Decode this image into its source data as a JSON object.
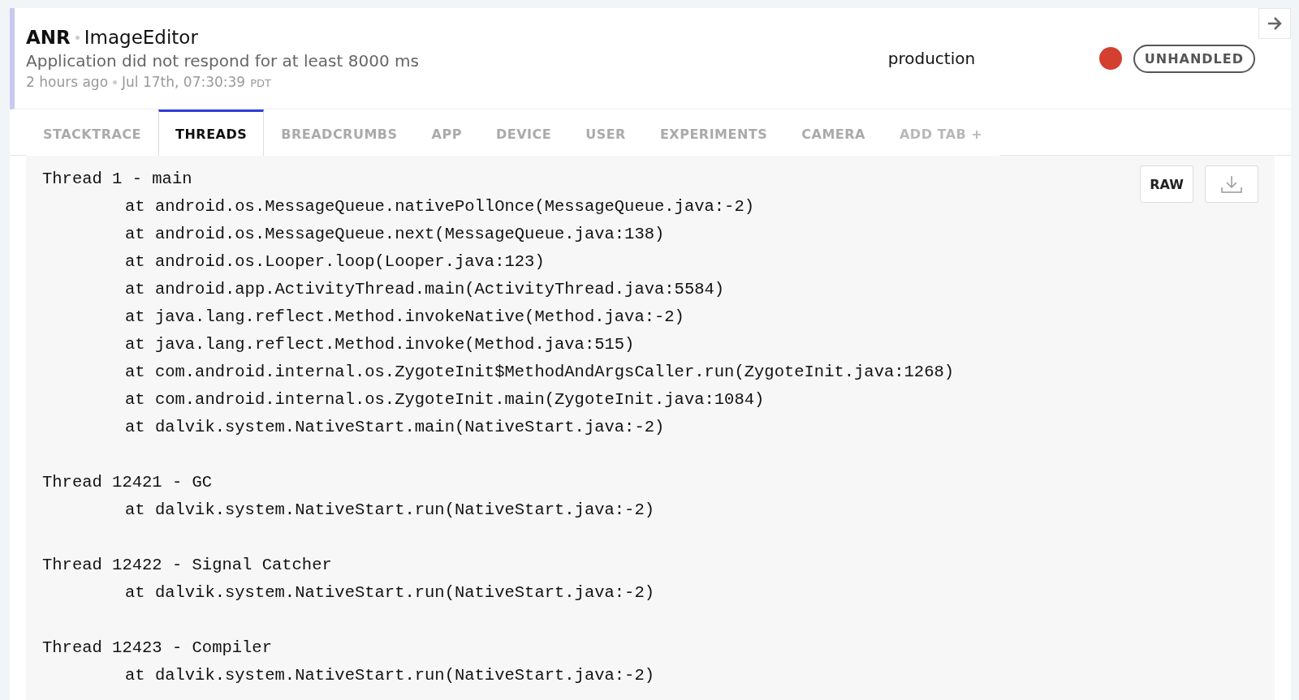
{
  "event": {
    "type": "ANR",
    "app": "ImageEditor",
    "message": "Application did not respond for at least 8000 ms",
    "relative_time": "2 hours ago",
    "timestamp": "Jul 17th, 07:30:39",
    "timezone": "PDT",
    "release_stage": "production",
    "severity_dot_on": true,
    "handled_label": "UNHANDLED"
  },
  "tabs": [
    {
      "label": "STACKTRACE",
      "selected": false
    },
    {
      "label": "THREADS",
      "selected": true
    },
    {
      "label": "BREADCRUMBS",
      "selected": false
    },
    {
      "label": "APP",
      "selected": false
    },
    {
      "label": "DEVICE",
      "selected": false
    },
    {
      "label": "USER",
      "selected": false
    },
    {
      "label": "EXPERIMENTS",
      "selected": false
    },
    {
      "label": "CAMERA",
      "selected": false
    }
  ],
  "add_tab": "ADD TAB +",
  "raw_button": "RAW",
  "threads": [
    {
      "title": "Thread 1 - main",
      "frames": [
        "at android.os.MessageQueue.nativePollOnce(MessageQueue.java:-2)",
        "at android.os.MessageQueue.next(MessageQueue.java:138)",
        "at android.os.Looper.loop(Looper.java:123)",
        "at android.app.ActivityThread.main(ActivityThread.java:5584)",
        "at java.lang.reflect.Method.invokeNative(Method.java:-2)",
        "at java.lang.reflect.Method.invoke(Method.java:515)",
        "at com.android.internal.os.ZygoteInit$MethodAndArgsCaller.run(ZygoteInit.java:1268)",
        "at com.android.internal.os.ZygoteInit.main(ZygoteInit.java:1084)",
        "at dalvik.system.NativeStart.main(NativeStart.java:-2)"
      ]
    },
    {
      "title": "Thread 12421 - GC",
      "frames": [
        "at dalvik.system.NativeStart.run(NativeStart.java:-2)"
      ]
    },
    {
      "title": "Thread 12422 - Signal Catcher",
      "frames": [
        "at dalvik.system.NativeStart.run(NativeStart.java:-2)"
      ]
    },
    {
      "title": "Thread 12423 - Compiler",
      "frames": [
        "at dalvik.system.NativeStart.run(NativeStart.java:-2)"
      ]
    }
  ]
}
